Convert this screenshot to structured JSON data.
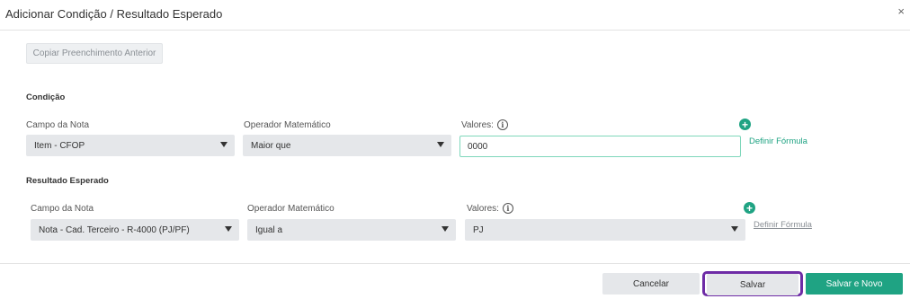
{
  "modal": {
    "title": "Adicionar Condição / Resultado Esperado",
    "close": "×"
  },
  "copy_button": "Copiar Preenchimento Anterior",
  "condicao": {
    "section_title": "Condição",
    "campo_label": "Campo da Nota",
    "campo_value": "Item - CFOP",
    "operador_label": "Operador Matemático",
    "operador_value": "Maior que",
    "valores_label": "Valores:",
    "valores_value": "0000",
    "formula_link": "Definir Fórmula",
    "add_icon": "plus-circle-icon"
  },
  "resultado": {
    "section_title": "Resultado Esperado",
    "campo_label": "Campo da Nota",
    "campo_value": "Nota - Cad. Terceiro - R-4000 (PJ/PF)",
    "operador_label": "Operador Matemático",
    "operador_value": "Igual a",
    "valores_label": "Valores:",
    "valores_value": "PJ",
    "formula_link": "Definir Fórmula",
    "add_icon": "plus-circle-icon"
  },
  "info_glyph": "i",
  "plus_glyph": "+",
  "footer": {
    "cancel": "Cancelar",
    "save": "Salvar",
    "save_new": "Salvar e Novo"
  },
  "colors": {
    "accent": "#1fa383",
    "highlight": "#6e2ca6",
    "input_border": "#7fd7bb"
  }
}
